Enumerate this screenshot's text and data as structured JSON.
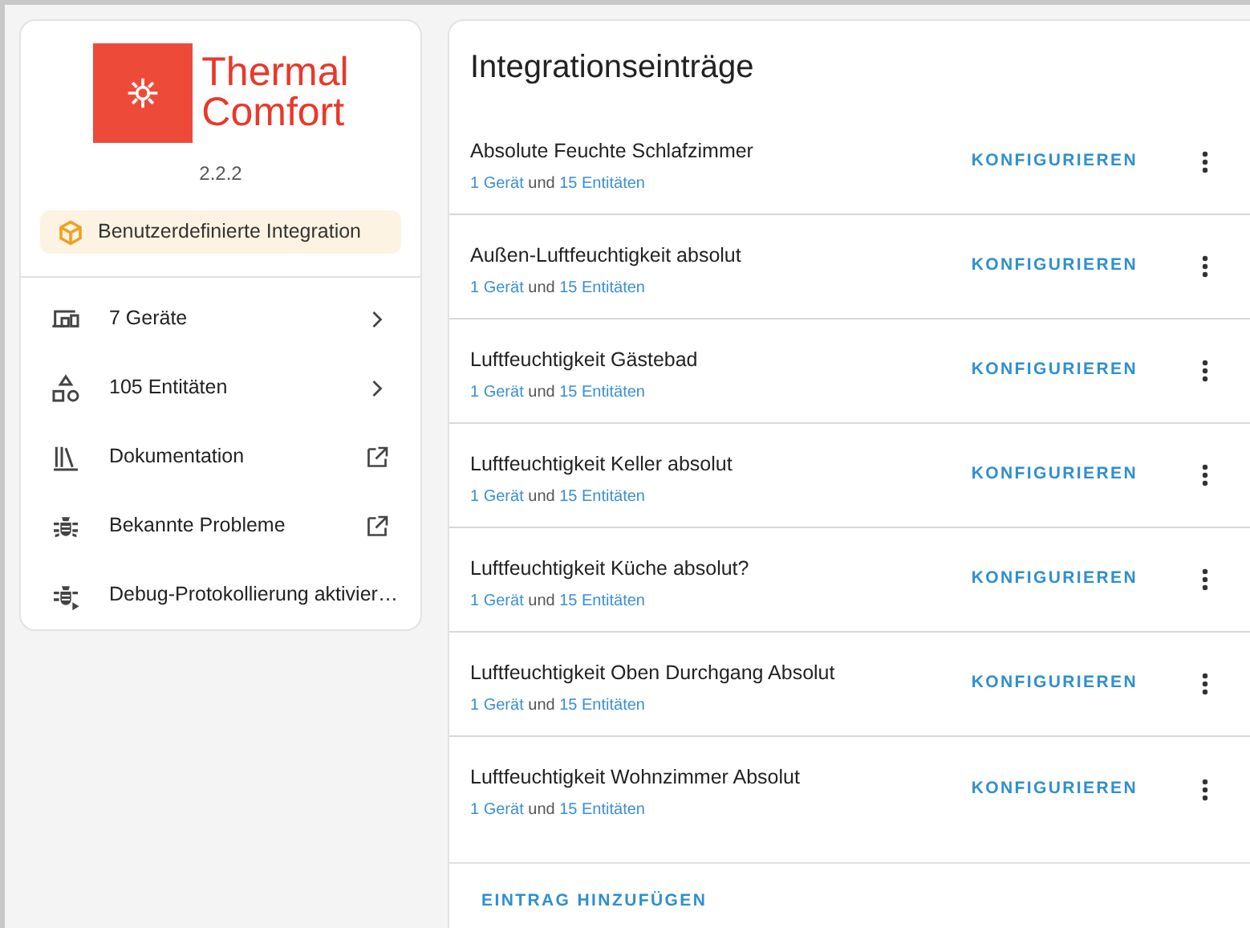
{
  "integration": {
    "logo_line_1": "Thermal",
    "logo_line_2": "Comfort",
    "version": "2.2.2",
    "badge": "Benutzerdefinierte Integration"
  },
  "menu": [
    {
      "label": "7 Geräte",
      "kind": "chevron"
    },
    {
      "label": "105 Entitäten",
      "kind": "chevron"
    },
    {
      "label": "Dokumentation",
      "kind": "external"
    },
    {
      "label": "Bekannte Probleme",
      "kind": "external"
    },
    {
      "label": "Debug-Protokollierung aktivier…",
      "kind": "none"
    }
  ],
  "entries_card": {
    "title": "Integrationseinträge",
    "add_button": "EINTRAG HINZUFÜGEN"
  },
  "entries": [
    {
      "name": "Absolute Feuchte Schlafzimmer",
      "devices": "1 Gerät",
      "conjunction": "und",
      "entities": "15 Entitäten",
      "action": "KONFIGURIEREN"
    },
    {
      "name": "Außen-Luftfeuchtigkeit absolut",
      "devices": "1 Gerät",
      "conjunction": "und",
      "entities": "15 Entitäten",
      "action": "KONFIGURIEREN"
    },
    {
      "name": "Luftfeuchtigkeit Gästebad",
      "devices": "1 Gerät",
      "conjunction": "und",
      "entities": "15 Entitäten",
      "action": "KONFIGURIEREN"
    },
    {
      "name": "Luftfeuchtigkeit Keller absolut",
      "devices": "1 Gerät",
      "conjunction": "und",
      "entities": "15 Entitäten",
      "action": "KONFIGURIEREN"
    },
    {
      "name": "Luftfeuchtigkeit Küche absolut?",
      "devices": "1 Gerät",
      "conjunction": "und",
      "entities": "15 Entitäten",
      "action": "KONFIGURIEREN"
    },
    {
      "name": "Luftfeuchtigkeit Oben Durchgang Absolut",
      "devices": "1 Gerät",
      "conjunction": "und",
      "entities": "15 Entitäten",
      "action": "KONFIGURIEREN"
    },
    {
      "name": "Luftfeuchtigkeit Wohnzimmer Absolut",
      "devices": "1 Gerät",
      "conjunction": "und",
      "entities": "15 Entitäten",
      "action": "KONFIGURIEREN"
    }
  ]
}
